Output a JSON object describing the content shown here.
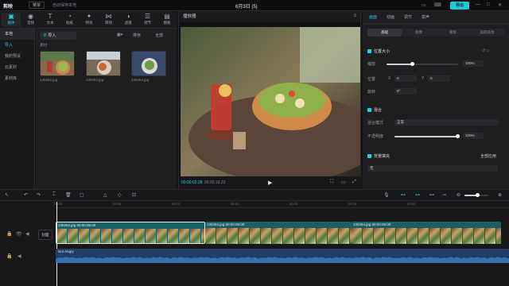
{
  "titlebar": {
    "logo": "剪映",
    "menu": "菜单",
    "autosave": "自动保存本地",
    "project_title": "6月3日 (5)",
    "export_label": "导出"
  },
  "toolbar_tabs": [
    {
      "icon": "media-icon",
      "glyph": "▣",
      "label": "媒体"
    },
    {
      "icon": "audio-icon",
      "glyph": "◉",
      "label": "音频"
    },
    {
      "icon": "text-icon",
      "glyph": "T",
      "label": "文本"
    },
    {
      "icon": "sticker-icon",
      "glyph": "◔",
      "label": "贴纸"
    },
    {
      "icon": "effects-icon",
      "glyph": "✦",
      "label": "特效"
    },
    {
      "icon": "transition-icon",
      "glyph": "⋈",
      "label": "转场"
    },
    {
      "icon": "filter-icon",
      "glyph": "◑",
      "label": "滤镜"
    },
    {
      "icon": "adjust-icon",
      "glyph": "☰",
      "label": "调节"
    },
    {
      "icon": "template-icon",
      "glyph": "▤",
      "label": "模板"
    }
  ],
  "left_nav": {
    "items": [
      "本地",
      "导入",
      "我的预设",
      "云素材",
      "素材库"
    ]
  },
  "media": {
    "import_label": "导入",
    "sort_label": "排序",
    "all_label": "全部",
    "section_label": "素材",
    "files": [
      "135262.jpg",
      "135263.jpg",
      "135264.jpg"
    ]
  },
  "player": {
    "title": "播放器",
    "current_time": "00:00:02:28",
    "total_time": "00:03:19:22"
  },
  "inspector": {
    "tabs": [
      "画面",
      "动画",
      "调节",
      "变声"
    ],
    "subtabs": [
      "基础",
      "抠像",
      "蒙版",
      "美颜美体"
    ],
    "sections": {
      "position_size": "位置大小",
      "scale_label": "缩放",
      "scale_value": "100%",
      "scale_fraction": 1.0,
      "position_label": "位置",
      "pos_x": "0",
      "pos_y": "0",
      "rotate_label": "旋转",
      "rotate_value": "0°",
      "blend": "混合",
      "blend_mode_label": "混合模式",
      "blend_mode_value": "正常",
      "opacity_label": "不透明度",
      "opacity_value": "100%",
      "opacity_fraction": 1.0,
      "bg_fill": "背景填充",
      "bg_fill_apply": "全部应用",
      "bg_fill_value": "无"
    }
  },
  "timeline": {
    "ruler_ticks": [
      "00:00",
      "00:05",
      "00:10",
      "00:15",
      "00:20",
      "00:25",
      "00:30"
    ],
    "cover_label": "封面",
    "clips": [
      "135262.jpg  00:00:05:00",
      "135263.jpg  00:00:05:00",
      "135264.jpg  00:00:05:00"
    ],
    "audio_label": "Not Angry"
  },
  "colors": {
    "accent": "#20d3e3",
    "clip": "#1b5f66",
    "audio": "#1f3d66"
  }
}
